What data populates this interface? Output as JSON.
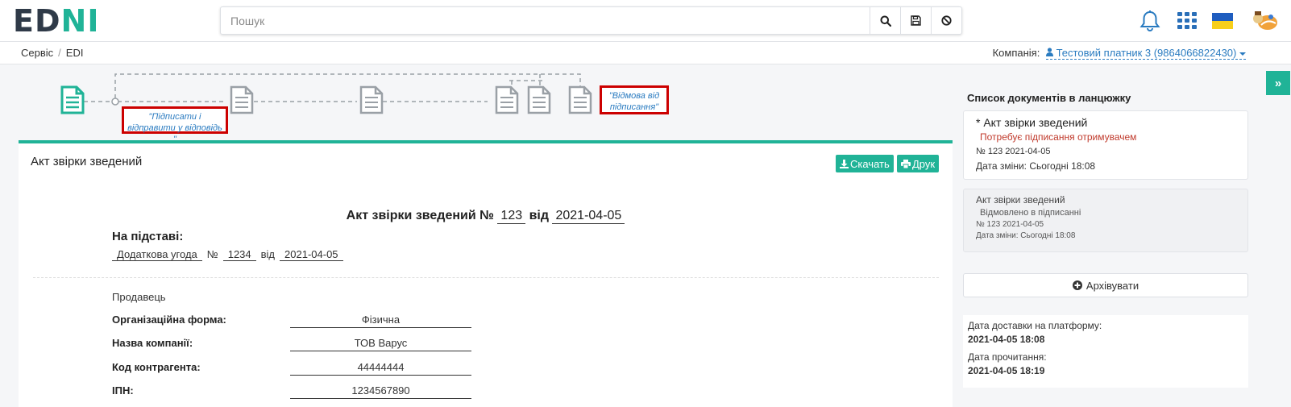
{
  "header": {
    "logo_left": "ED",
    "logo_right": "NI",
    "search_placeholder": "Пошук"
  },
  "breadcrumb": {
    "items": [
      "Сервіс",
      "EDI"
    ],
    "separator": "/"
  },
  "company": {
    "label": "Компанія:",
    "name": "Тестовий платник 3 (9864066822430)"
  },
  "side_toggle": "»",
  "chain": {
    "callout_sign": "\"Підписати і відправити у відповідь \"",
    "callout_reject": "\"Відмова від підписання\""
  },
  "document": {
    "header_title": "Акт звірки зведений",
    "download_label": "Скачать",
    "print_label": "Друк",
    "title_prefix": "Акт звірки зведений №",
    "number": "123",
    "date_prefix": "від",
    "date": "2021-04-05",
    "basis_label": "На підставі:",
    "basis_doc": "Додаткова угода",
    "basis_no_label": "№",
    "basis_no": "1234",
    "basis_from": "від",
    "basis_date": "2021-04-05",
    "seller_label": "Продавець",
    "fields": [
      {
        "label": "Організаційна форма:",
        "value": "Фізична"
      },
      {
        "label": "Назва компанії:",
        "value": "ТОВ Варус"
      },
      {
        "label": "Код контрагента:",
        "value": "44444444"
      },
      {
        "label": "ІПН:",
        "value": "1234567890"
      }
    ]
  },
  "panel": {
    "title": "Список документів в ланцюжку",
    "docs": [
      {
        "title": "* Акт звірки зведений",
        "status": "Потребує підписання отримувачем",
        "number": "№ 123 2021-04-05",
        "changed": "Дата зміни: Сьогодні 18:08"
      },
      {
        "title": "Акт звірки зведений",
        "status": "Відмовлено в підписанні",
        "number": "№ 123 2021-04-05",
        "changed": "Дата зміни: Сьогодні 18:08"
      }
    ],
    "archive_label": "Архівувати",
    "delivery_label": "Дата доставки на платформу:",
    "delivery_value": "2021-04-05 18:08",
    "read_label": "Дата прочитання:",
    "read_value": "2021-04-05 18:19"
  },
  "colors": {
    "accent": "#20b397",
    "link": "#2a7bc0",
    "alert": "#c00000"
  }
}
